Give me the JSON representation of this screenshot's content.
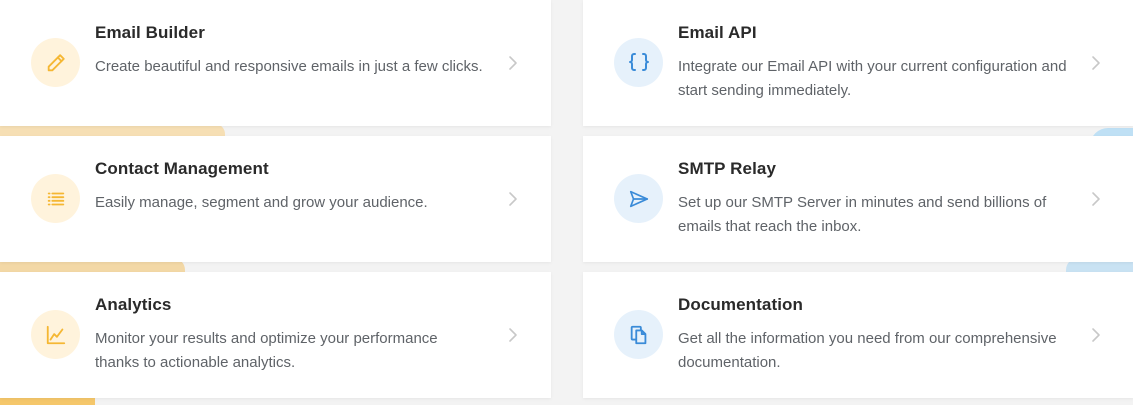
{
  "colors": {
    "accent_orange": "#f5b733",
    "accent_blue": "#3a8bd8",
    "chevron": "#c8c8c8"
  },
  "cards": [
    {
      "title": "Email Builder",
      "description": "Create beautiful and responsive emails in just a few clicks.",
      "icon": "pencil-icon"
    },
    {
      "title": "Email API",
      "description": "Integrate our Email API with your current configuration and start sending immediately.",
      "icon": "curly-braces-icon"
    },
    {
      "title": "Contact Management",
      "description": "Easily manage, segment and grow your audience.",
      "icon": "list-icon"
    },
    {
      "title": "SMTP Relay",
      "description": "Set up our SMTP Server in minutes and send billions of emails that reach the inbox.",
      "icon": "send-icon"
    },
    {
      "title": "Analytics",
      "description": "Monitor your results and optimize your performance thanks to actionable analytics.",
      "icon": "line-chart-icon"
    },
    {
      "title": "Documentation",
      "description": "Get all the information you need from our comprehensive documentation.",
      "icon": "documents-icon"
    }
  ]
}
